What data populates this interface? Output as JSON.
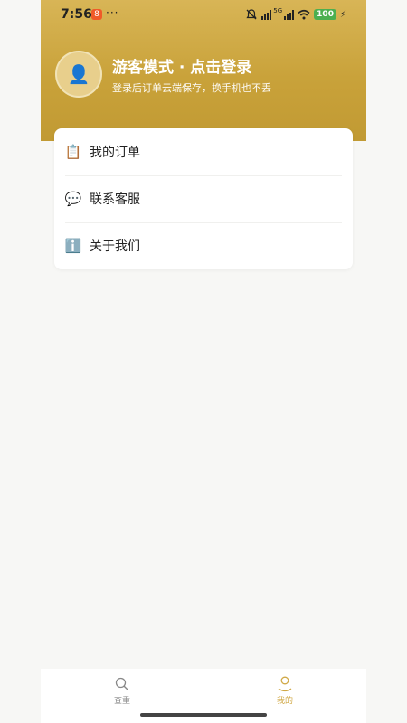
{
  "status_bar": {
    "time": "7:56",
    "notification_badge": "8",
    "more": "···",
    "network": "5G",
    "battery": "100"
  },
  "profile": {
    "avatar_icon": "user-silhouette",
    "title": "游客模式 · 点击登录",
    "subtitle": "登录后订单云端保存，换手机也不丢"
  },
  "menu": {
    "items": [
      {
        "icon": "📋",
        "icon_name": "clipboard-icon",
        "label": "我的订单"
      },
      {
        "icon": "💬",
        "icon_name": "speech-bubble-icon",
        "label": "联系客服"
      },
      {
        "icon": "ℹ️",
        "icon_name": "info-icon",
        "label": "关于我们"
      }
    ]
  },
  "tabbar": {
    "tabs": [
      {
        "label": "查重",
        "active": false
      },
      {
        "label": "我的",
        "active": true
      }
    ],
    "colors": {
      "active": "#d0a845",
      "inactive": "#888888"
    }
  },
  "colors": {
    "header_top": "#d8b556",
    "header_bottom": "#c19a33",
    "background": "#f7f7f5"
  }
}
